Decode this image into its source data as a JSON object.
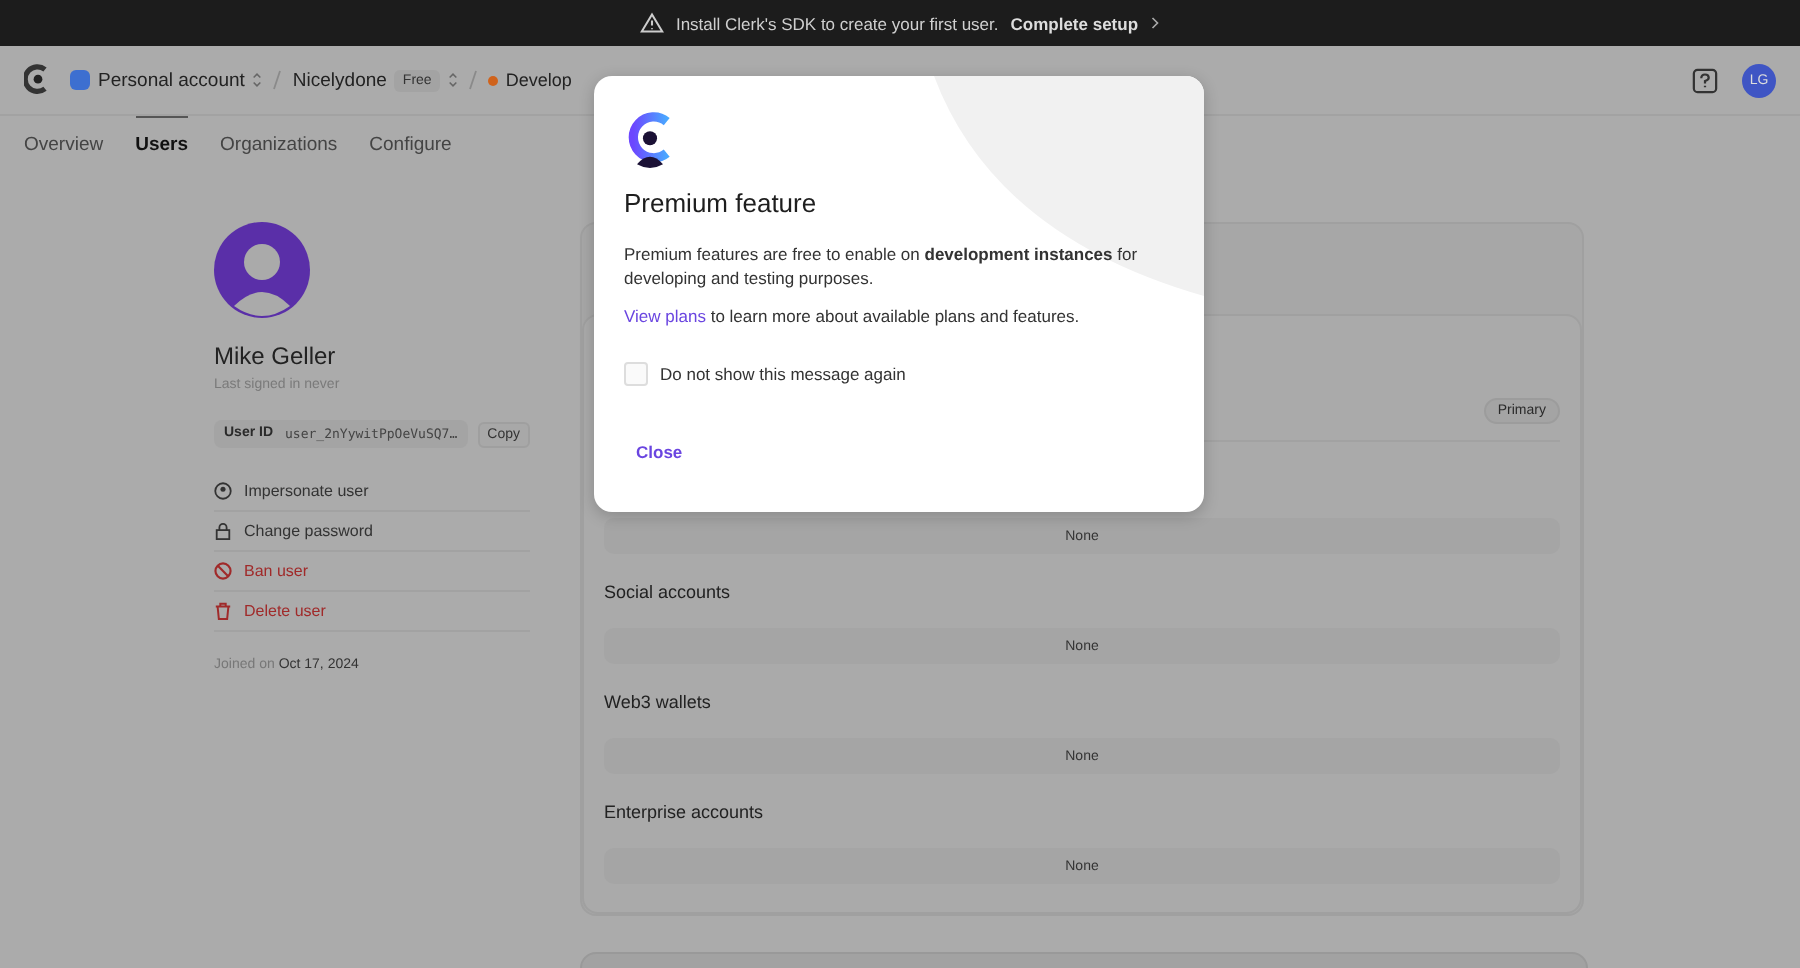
{
  "banner": {
    "text": "Install Clerk's SDK to create your first user.",
    "link": "Complete setup"
  },
  "header": {
    "account": "Personal account",
    "app": "Nicelydone",
    "plan": "Free",
    "instance": "Develop",
    "avatar": "LG"
  },
  "tabs": [
    {
      "label": "Overview",
      "selected": false
    },
    {
      "label": "Users",
      "selected": true
    },
    {
      "label": "Organizations",
      "selected": false
    },
    {
      "label": "Configure",
      "selected": false
    }
  ],
  "user": {
    "name": "Mike Geller",
    "last_signed": "Last signed in never",
    "id_label": "User ID",
    "id_value": "user_2nYywitPpOeVuSQ7…",
    "copy": "Copy",
    "actions": [
      {
        "label": "Impersonate user",
        "kind": "person",
        "danger": false
      },
      {
        "label": "Change password",
        "kind": "lock",
        "danger": false
      },
      {
        "label": "Ban user",
        "kind": "ban",
        "danger": true
      },
      {
        "label": "Delete user",
        "kind": "trash",
        "danger": true
      }
    ],
    "joined_label": "Joined on",
    "joined_date": "Oct 17, 2024"
  },
  "primary_badge": "Primary",
  "sections": [
    {
      "value": "None"
    },
    {
      "title": "Social accounts",
      "value": "None"
    },
    {
      "title": "Web3 wallets",
      "value": "None"
    },
    {
      "title": "Enterprise accounts",
      "value": "None"
    }
  ],
  "modal": {
    "title": "Premium feature",
    "body": "Premium features are free to enable on **development instances** for developing and testing purposes.",
    "link": "View plans",
    "link_rest": "to learn more about available plans and features.",
    "checkbox": {
      "label": "Do not show this message again",
      "checked": false
    },
    "close": "Close"
  }
}
